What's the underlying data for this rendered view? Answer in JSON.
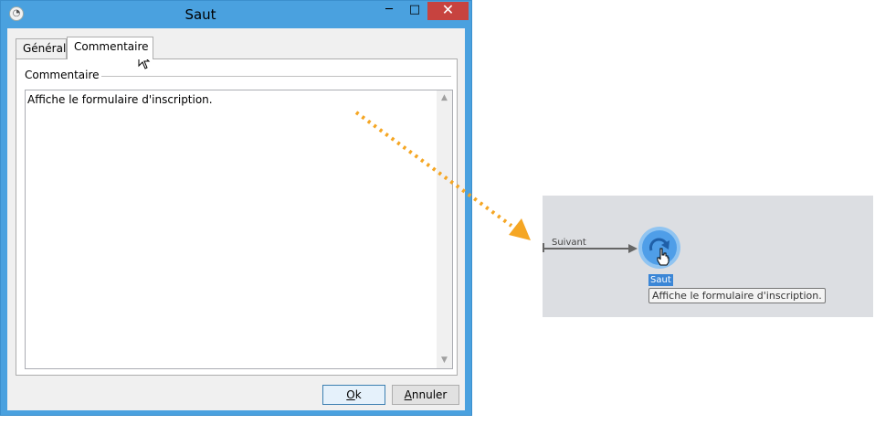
{
  "window": {
    "title": "Saut",
    "controls": {
      "minimize": "─",
      "maximize": "□",
      "close": "✕"
    }
  },
  "tabs": [
    {
      "label": "Général",
      "selected": false
    },
    {
      "label": "Commentaire",
      "selected": true
    }
  ],
  "comment_group": {
    "label": "Commentaire",
    "text": "Affiche le formulaire d'inscription."
  },
  "buttons": {
    "ok": {
      "mnemonic": "O",
      "rest": "k"
    },
    "cancel": {
      "mnemonic": "A",
      "rest": "nnuler"
    }
  },
  "canvas": {
    "transition_label": "Suivant",
    "node_label": "Saut",
    "tooltip": "Affiche le formulaire d'inscription."
  },
  "colors": {
    "window_frame": "#4aa1df",
    "close_button": "#c7433f",
    "canvas_background": "#dcdee2",
    "node": "#4f9ee8",
    "annotation_arrow": "#f5a623"
  },
  "icons": {
    "app": "app-icon",
    "node": "jump-icon",
    "hand_cursor": "hand-cursor-icon"
  }
}
